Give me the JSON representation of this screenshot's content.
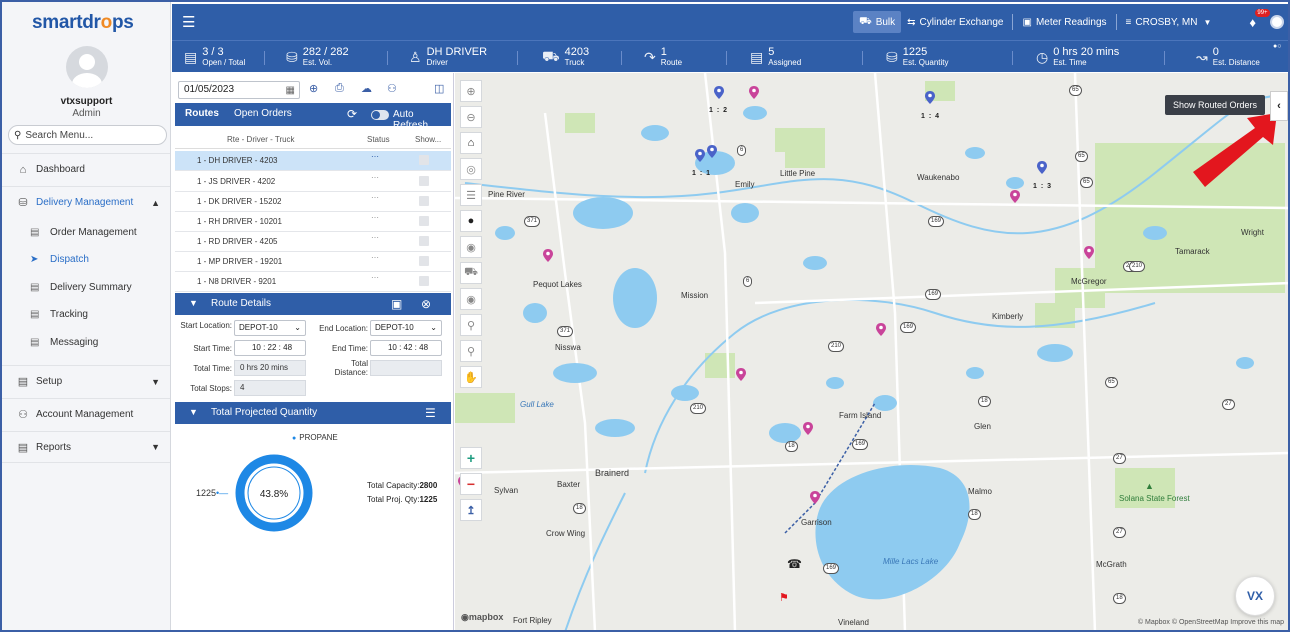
{
  "app": {
    "logo_text": "smartdr",
    "logo_drop": "o",
    "logo_tail": "ps"
  },
  "user": {
    "name": "vtxsupport",
    "role": "Admin"
  },
  "sidebar": {
    "search_placeholder": "Search Menu...",
    "items": [
      {
        "label": "Dashboard",
        "icon": "home-icon"
      },
      {
        "label": "Delivery Management",
        "icon": "truck-icon",
        "expanded": true
      },
      {
        "label": "Setup",
        "icon": "setup-icon"
      },
      {
        "label": "Account Management",
        "icon": "users-icon"
      },
      {
        "label": "Reports",
        "icon": "report-icon"
      }
    ],
    "sub_items": [
      {
        "label": "Order Management"
      },
      {
        "label": "Dispatch",
        "active": true
      },
      {
        "label": "Delivery Summary"
      },
      {
        "label": "Tracking"
      },
      {
        "label": "Messaging"
      }
    ]
  },
  "topbar": {
    "bulk": "Bulk",
    "cylinder": "Cylinder Exchange",
    "meter": "Meter Readings",
    "location": "CROSBY, MN",
    "badge": "99+"
  },
  "stats": [
    {
      "value": "3 / 3",
      "label": "Open / Total"
    },
    {
      "value": "282 / 282",
      "label": "Est. Vol."
    },
    {
      "value": "DH DRIVER",
      "label": "Driver"
    },
    {
      "value": "4203",
      "label": "Truck"
    },
    {
      "value": "1",
      "label": "Route"
    },
    {
      "value": "5",
      "label": "Assigned"
    },
    {
      "value": "1225",
      "label": "Est. Quantity"
    },
    {
      "value": "0 hrs 20 mins",
      "label": "Est. Time"
    },
    {
      "value": "0",
      "label": "Est. Distance"
    }
  ],
  "panel": {
    "date": "01/05/2023",
    "tabs": {
      "routes": "Routes",
      "open_orders": "Open Orders",
      "auto_refresh": "Auto Refresh"
    },
    "columns": {
      "route": "Rte - Driver - Truck",
      "status": "Status",
      "show": "Show..."
    },
    "routes": [
      "1 - DH DRIVER - 4203",
      "1 - JS DRIVER - 4202",
      "1 - DK DRIVER - 15202",
      "1 - RH DRIVER - 10201",
      "1 - RD DRIVER - 4205",
      "1 - MP DRIVER - 19201",
      "1 - N8 DRIVER - 9201"
    ],
    "route_details": {
      "title": "Route Details",
      "start_location_label": "Start Location:",
      "start_location": "DEPOT-10",
      "end_location_label": "End Location:",
      "end_location": "DEPOT-10",
      "start_time_label": "Start Time:",
      "start_time": "10 : 22 : 48",
      "end_time_label": "End Time:",
      "end_time": "10 : 42 : 48",
      "total_time_label": "Total Time:",
      "total_time": "0 hrs 20 mins",
      "total_distance_label": "Total Distance:",
      "total_distance": "",
      "total_stops_label": "Total Stops:",
      "total_stops": "4"
    },
    "projected": {
      "title": "Total Projected Quantity",
      "legend": "PROPANE",
      "quantity": "1225",
      "percent_label": "43.8%",
      "percent": 43.8,
      "capacity_label": "Total Capacity:",
      "capacity": "2800",
      "proj_label": "Total Proj. Qty:",
      "proj": "1225"
    }
  },
  "map": {
    "tooltip": "Show Routed Orders",
    "attribution": "© Mapbox © OpenStreetMap  Improve this map",
    "mapbox": "mapbox",
    "vx": "VX",
    "places": [
      "Pine River",
      "Emily",
      "Little Pine",
      "Waukenabo",
      "Tamarack",
      "Wright",
      "Pequot Lakes",
      "Mission",
      "McGregor",
      "Kimberly",
      "Nisswa",
      "Farm Island",
      "Gull Lake",
      "Glen",
      "Brainerd",
      "Baxter",
      "Sylvan",
      "Malmo",
      "Solana State Forest",
      "Garrison",
      "Crow Wing",
      "Mille Lacs Lake",
      "McGrath",
      "Fort Ripley",
      "Vineland"
    ],
    "pin_labels": [
      "1 : 2",
      "1 : 4",
      "1 : 3",
      "1 : 1"
    ],
    "highways": [
      "65",
      "6",
      "371",
      "169",
      "210",
      "210",
      "169",
      "210",
      "6",
      "169",
      "65",
      "18",
      "27",
      "65",
      "371",
      "210",
      "27",
      "18",
      "169",
      "18",
      "65",
      "27",
      "169",
      "18",
      "18",
      "27",
      "210"
    ]
  },
  "colors": {
    "primary": "#2f5ea8",
    "water": "#8ecbf0",
    "accent": "#f08a24"
  }
}
